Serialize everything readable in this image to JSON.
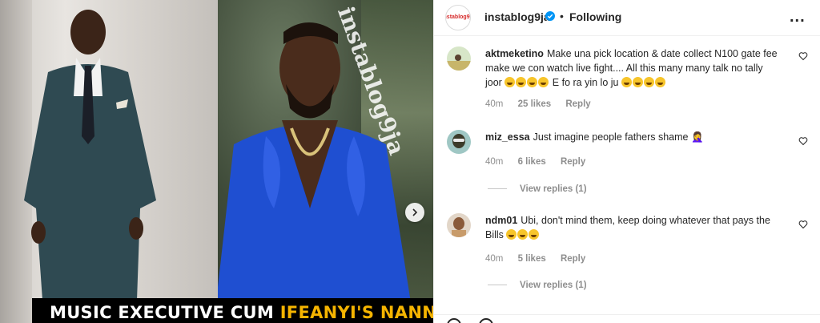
{
  "media": {
    "watermark": "instablog9ja",
    "caption_part1": "MUSIC EXECUTIVE CUM ",
    "caption_highlight": "IFEANYI'S NANNY,",
    "next_icon": "chevron-right-icon"
  },
  "header": {
    "avatar_logo": "instablog9ja",
    "username": "instablog9ja",
    "verified_icon": "verified-badge-icon",
    "separator": "•",
    "follow_status": "Following",
    "more_icon": "more-options-icon",
    "more_label": "..."
  },
  "comments": [
    {
      "username": "aktmeketino",
      "text": "Make una pick location & date collect N100 gate fee make we con watch live fight.... All this many many talk no tally joor",
      "emojis_mid": 4,
      "text2": " E fo ra yin lo ju",
      "emojis_end": 4,
      "time": "40m",
      "likes": "25 likes",
      "reply": "Reply"
    },
    {
      "username": "miz_essa",
      "text": "Just imagine people fathers shame",
      "trailing_emoji": "🤦‍♀️",
      "time": "40m",
      "likes": "6 likes",
      "reply": "Reply",
      "view_replies": "View replies (1)"
    },
    {
      "username": "ndm01",
      "text": "Ubi, don't mind them, keep doing whatever that pays the Bills",
      "emojis_end": 3,
      "time": "40m",
      "likes": "5 likes",
      "reply": "Reply",
      "view_replies": "View replies (1)"
    }
  ],
  "colors": {
    "highlight": "#f5b400",
    "muted": "#8e8e8e",
    "text": "#262626",
    "verified": "#0095f6"
  }
}
